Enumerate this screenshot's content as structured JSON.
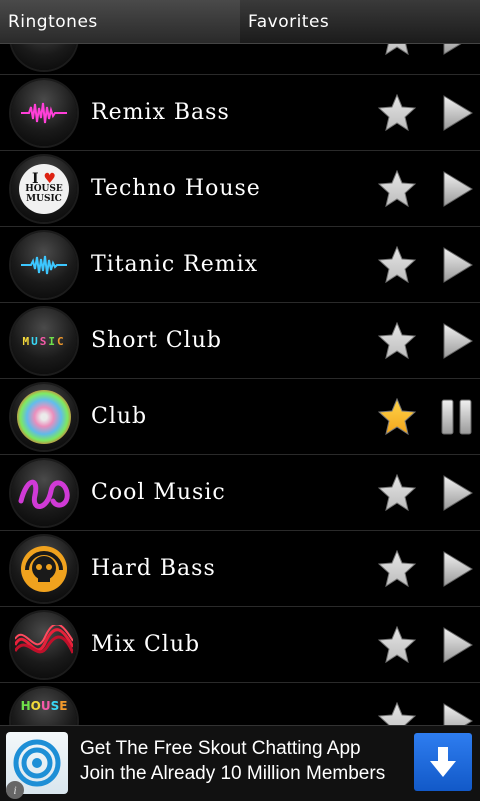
{
  "tabs": [
    {
      "label": "Ringtones",
      "active": true
    },
    {
      "label": "Favorites",
      "active": false
    }
  ],
  "rows": [
    {
      "title": "",
      "thumb_icon": "stacked-disc-icon",
      "favorite": false,
      "state": "play"
    },
    {
      "title": "Remix Bass",
      "thumb_icon": "pink-waveform-icon",
      "favorite": false,
      "state": "play"
    },
    {
      "title": "Techno House",
      "thumb_icon": "i-love-house-music-icon",
      "favorite": false,
      "state": "play"
    },
    {
      "title": "Titanic Remix",
      "thumb_icon": "blue-waveform-icon",
      "favorite": false,
      "state": "play"
    },
    {
      "title": "Short Club",
      "thumb_icon": "music-letters-icon",
      "favorite": false,
      "state": "play"
    },
    {
      "title": "Club",
      "thumb_icon": "disco-ball-icon",
      "favorite": true,
      "state": "pause"
    },
    {
      "title": "Cool Music",
      "thumb_icon": "purple-swirl-icon",
      "favorite": false,
      "state": "play"
    },
    {
      "title": "Hard Bass",
      "thumb_icon": "skull-headphones-icon",
      "favorite": false,
      "state": "play"
    },
    {
      "title": "Mix Club",
      "thumb_icon": "red-wave-icon",
      "favorite": false,
      "state": "play"
    },
    {
      "title": "",
      "thumb_icon": "house-letters-icon",
      "favorite": false,
      "state": "play"
    }
  ],
  "ad": {
    "line1": "Get The Free Skout Chatting App",
    "line2": "Join the Already 10 Million Members",
    "logo_icon": "skout-logo-icon",
    "download_icon": "download-arrow-icon",
    "info_icon": "info-icon",
    "info_glyph": "i"
  },
  "colors": {
    "star_off": "#bdbdbd",
    "star_on": "#f2a51c",
    "play": "#c8c8c8",
    "ad_button": "#1e6be0"
  }
}
